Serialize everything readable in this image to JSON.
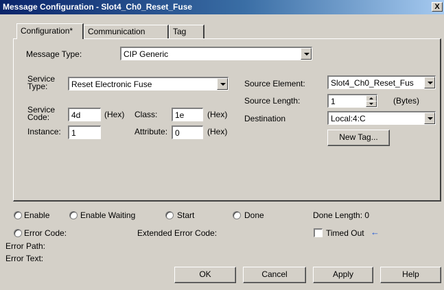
{
  "window": {
    "title": "Message Configuration - Slot4_Ch0_Reset_Fuse",
    "close_label": "X"
  },
  "tabs": [
    {
      "label": "Configuration*"
    },
    {
      "label": "Communication"
    },
    {
      "label": "Tag"
    }
  ],
  "config": {
    "message_type_label": "Message Type:",
    "message_type_value": "CIP Generic",
    "service_type_label": "Service Type:",
    "service_type_value": "Reset Electronic Fuse",
    "service_code_label": "Service Code:",
    "service_code_value": "4d",
    "hex_label": "(Hex)",
    "class_label": "Class:",
    "class_value": "1e",
    "instance_label": "Instance:",
    "instance_value": "1",
    "attribute_label": "Attribute:",
    "attribute_value": "0",
    "source_element_label": "Source Element:",
    "source_element_value": "Slot4_Ch0_Reset_Fus",
    "source_length_label": "Source Length:",
    "source_length_value": "1",
    "bytes_label": "(Bytes)",
    "destination_label": "Destination",
    "destination_value": "Local:4:C",
    "new_tag_label": "New Tag..."
  },
  "status": {
    "enable": "Enable",
    "enable_waiting": "Enable Waiting",
    "start": "Start",
    "done": "Done",
    "done_length": "Done Length: 0",
    "error_code": "Error Code:",
    "extended_error_code": "Extended Error Code:",
    "timed_out": "Timed Out",
    "error_path": "Error Path:",
    "error_text": "Error Text:"
  },
  "buttons": {
    "ok": "OK",
    "cancel": "Cancel",
    "apply": "Apply",
    "help": "Help"
  },
  "colors": {
    "title_start": "#0a246a",
    "title_end": "#a6caf0",
    "face": "#d4d0c8",
    "arrow": "#1f57d6"
  }
}
